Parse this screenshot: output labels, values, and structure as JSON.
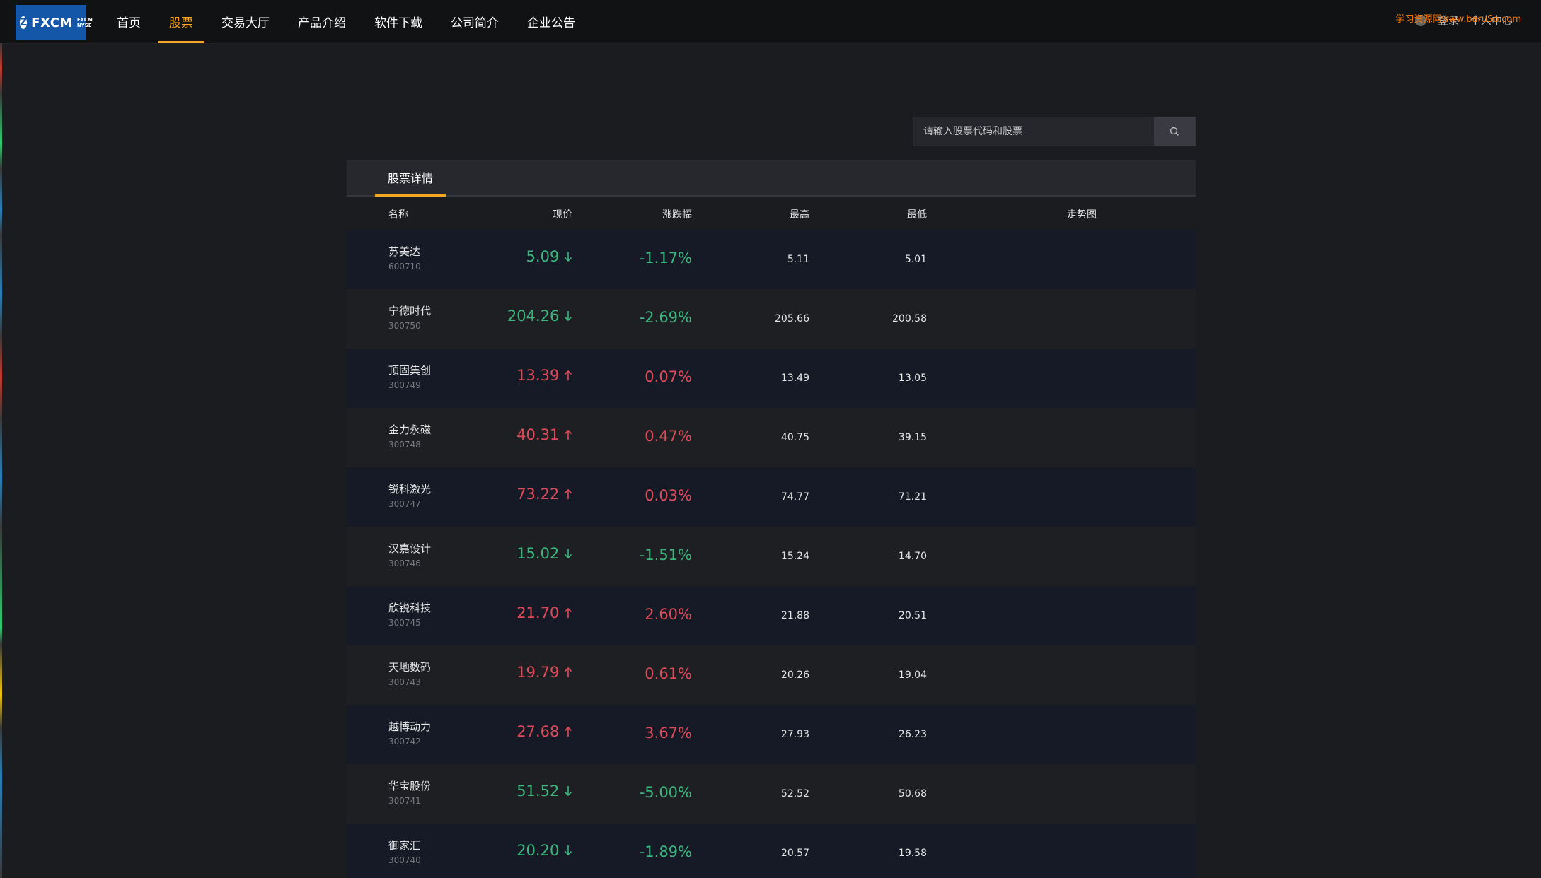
{
  "nav": {
    "logo": {
      "text": "FXCM",
      "sub_top": "FXCM",
      "sub_bottom": "NYSE"
    },
    "items": [
      {
        "label": "首页",
        "active": false
      },
      {
        "label": "股票",
        "active": true
      },
      {
        "label": "交易大厅",
        "active": false
      },
      {
        "label": "产品介绍",
        "active": false
      },
      {
        "label": "软件下载",
        "active": false
      },
      {
        "label": "公司简介",
        "active": false
      },
      {
        "label": "企业公告",
        "active": false
      }
    ],
    "user": {
      "login_label": "登录",
      "center_label": "个人中心"
    },
    "watermark": "学习资源网www.baruSo.com"
  },
  "search": {
    "placeholder": "请输入股票代码和股票",
    "value": ""
  },
  "panel": {
    "tab_label": "股票详情",
    "columns": {
      "name": "名称",
      "price": "现价",
      "change": "涨跌幅",
      "high": "最高",
      "low": "最低",
      "trend": "走势图"
    },
    "rows": [
      {
        "name": "苏美达",
        "code": "600710",
        "price": "5.09",
        "direction": "down",
        "change": "-1.17%",
        "high": "5.11",
        "low": "5.01"
      },
      {
        "name": "宁德时代",
        "code": "300750",
        "price": "204.26",
        "direction": "down",
        "change": "-2.69%",
        "high": "205.66",
        "low": "200.58"
      },
      {
        "name": "顶固集创",
        "code": "300749",
        "price": "13.39",
        "direction": "up",
        "change": "0.07%",
        "high": "13.49",
        "low": "13.05"
      },
      {
        "name": "金力永磁",
        "code": "300748",
        "price": "40.31",
        "direction": "up",
        "change": "0.47%",
        "high": "40.75",
        "low": "39.15"
      },
      {
        "name": "锐科激光",
        "code": "300747",
        "price": "73.22",
        "direction": "up",
        "change": "0.03%",
        "high": "74.77",
        "low": "71.21"
      },
      {
        "name": "汉嘉设计",
        "code": "300746",
        "price": "15.02",
        "direction": "down",
        "change": "-1.51%",
        "high": "15.24",
        "low": "14.70"
      },
      {
        "name": "欣锐科技",
        "code": "300745",
        "price": "21.70",
        "direction": "up",
        "change": "2.60%",
        "high": "21.88",
        "low": "20.51"
      },
      {
        "name": "天地数码",
        "code": "300743",
        "price": "19.79",
        "direction": "up",
        "change": "0.61%",
        "high": "20.26",
        "low": "19.04"
      },
      {
        "name": "越博动力",
        "code": "300742",
        "price": "27.68",
        "direction": "up",
        "change": "3.67%",
        "high": "27.93",
        "low": "26.23"
      },
      {
        "name": "华宝股份",
        "code": "300741",
        "price": "51.52",
        "direction": "down",
        "change": "-5.00%",
        "high": "52.52",
        "low": "50.68"
      },
      {
        "name": "御家汇",
        "code": "300740",
        "price": "20.20",
        "direction": "down",
        "change": "-1.89%",
        "high": "20.57",
        "low": "19.58"
      }
    ]
  },
  "colors": {
    "accent": "#f5a623",
    "up": "#e04b5a",
    "down": "#3bb77e",
    "background": "#1b1c20"
  },
  "icons": {
    "search": "search-icon",
    "arrow_up": "arrow-up-icon",
    "arrow_down": "arrow-down-icon",
    "user": "user-icon"
  }
}
